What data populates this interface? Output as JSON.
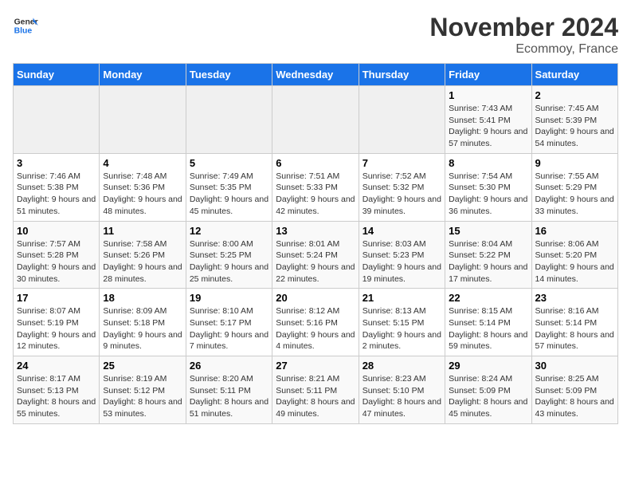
{
  "header": {
    "logo_line1": "General",
    "logo_line2": "Blue",
    "month": "November 2024",
    "location": "Ecommoy, France"
  },
  "weekdays": [
    "Sunday",
    "Monday",
    "Tuesday",
    "Wednesday",
    "Thursday",
    "Friday",
    "Saturday"
  ],
  "weeks": [
    [
      {
        "day": "",
        "info": ""
      },
      {
        "day": "",
        "info": ""
      },
      {
        "day": "",
        "info": ""
      },
      {
        "day": "",
        "info": ""
      },
      {
        "day": "",
        "info": ""
      },
      {
        "day": "1",
        "info": "Sunrise: 7:43 AM\nSunset: 5:41 PM\nDaylight: 9 hours and 57 minutes."
      },
      {
        "day": "2",
        "info": "Sunrise: 7:45 AM\nSunset: 5:39 PM\nDaylight: 9 hours and 54 minutes."
      }
    ],
    [
      {
        "day": "3",
        "info": "Sunrise: 7:46 AM\nSunset: 5:38 PM\nDaylight: 9 hours and 51 minutes."
      },
      {
        "day": "4",
        "info": "Sunrise: 7:48 AM\nSunset: 5:36 PM\nDaylight: 9 hours and 48 minutes."
      },
      {
        "day": "5",
        "info": "Sunrise: 7:49 AM\nSunset: 5:35 PM\nDaylight: 9 hours and 45 minutes."
      },
      {
        "day": "6",
        "info": "Sunrise: 7:51 AM\nSunset: 5:33 PM\nDaylight: 9 hours and 42 minutes."
      },
      {
        "day": "7",
        "info": "Sunrise: 7:52 AM\nSunset: 5:32 PM\nDaylight: 9 hours and 39 minutes."
      },
      {
        "day": "8",
        "info": "Sunrise: 7:54 AM\nSunset: 5:30 PM\nDaylight: 9 hours and 36 minutes."
      },
      {
        "day": "9",
        "info": "Sunrise: 7:55 AM\nSunset: 5:29 PM\nDaylight: 9 hours and 33 minutes."
      }
    ],
    [
      {
        "day": "10",
        "info": "Sunrise: 7:57 AM\nSunset: 5:28 PM\nDaylight: 9 hours and 30 minutes."
      },
      {
        "day": "11",
        "info": "Sunrise: 7:58 AM\nSunset: 5:26 PM\nDaylight: 9 hours and 28 minutes."
      },
      {
        "day": "12",
        "info": "Sunrise: 8:00 AM\nSunset: 5:25 PM\nDaylight: 9 hours and 25 minutes."
      },
      {
        "day": "13",
        "info": "Sunrise: 8:01 AM\nSunset: 5:24 PM\nDaylight: 9 hours and 22 minutes."
      },
      {
        "day": "14",
        "info": "Sunrise: 8:03 AM\nSunset: 5:23 PM\nDaylight: 9 hours and 19 minutes."
      },
      {
        "day": "15",
        "info": "Sunrise: 8:04 AM\nSunset: 5:22 PM\nDaylight: 9 hours and 17 minutes."
      },
      {
        "day": "16",
        "info": "Sunrise: 8:06 AM\nSunset: 5:20 PM\nDaylight: 9 hours and 14 minutes."
      }
    ],
    [
      {
        "day": "17",
        "info": "Sunrise: 8:07 AM\nSunset: 5:19 PM\nDaylight: 9 hours and 12 minutes."
      },
      {
        "day": "18",
        "info": "Sunrise: 8:09 AM\nSunset: 5:18 PM\nDaylight: 9 hours and 9 minutes."
      },
      {
        "day": "19",
        "info": "Sunrise: 8:10 AM\nSunset: 5:17 PM\nDaylight: 9 hours and 7 minutes."
      },
      {
        "day": "20",
        "info": "Sunrise: 8:12 AM\nSunset: 5:16 PM\nDaylight: 9 hours and 4 minutes."
      },
      {
        "day": "21",
        "info": "Sunrise: 8:13 AM\nSunset: 5:15 PM\nDaylight: 9 hours and 2 minutes."
      },
      {
        "day": "22",
        "info": "Sunrise: 8:15 AM\nSunset: 5:14 PM\nDaylight: 8 hours and 59 minutes."
      },
      {
        "day": "23",
        "info": "Sunrise: 8:16 AM\nSunset: 5:14 PM\nDaylight: 8 hours and 57 minutes."
      }
    ],
    [
      {
        "day": "24",
        "info": "Sunrise: 8:17 AM\nSunset: 5:13 PM\nDaylight: 8 hours and 55 minutes."
      },
      {
        "day": "25",
        "info": "Sunrise: 8:19 AM\nSunset: 5:12 PM\nDaylight: 8 hours and 53 minutes."
      },
      {
        "day": "26",
        "info": "Sunrise: 8:20 AM\nSunset: 5:11 PM\nDaylight: 8 hours and 51 minutes."
      },
      {
        "day": "27",
        "info": "Sunrise: 8:21 AM\nSunset: 5:11 PM\nDaylight: 8 hours and 49 minutes."
      },
      {
        "day": "28",
        "info": "Sunrise: 8:23 AM\nSunset: 5:10 PM\nDaylight: 8 hours and 47 minutes."
      },
      {
        "day": "29",
        "info": "Sunrise: 8:24 AM\nSunset: 5:09 PM\nDaylight: 8 hours and 45 minutes."
      },
      {
        "day": "30",
        "info": "Sunrise: 8:25 AM\nSunset: 5:09 PM\nDaylight: 8 hours and 43 minutes."
      }
    ]
  ]
}
